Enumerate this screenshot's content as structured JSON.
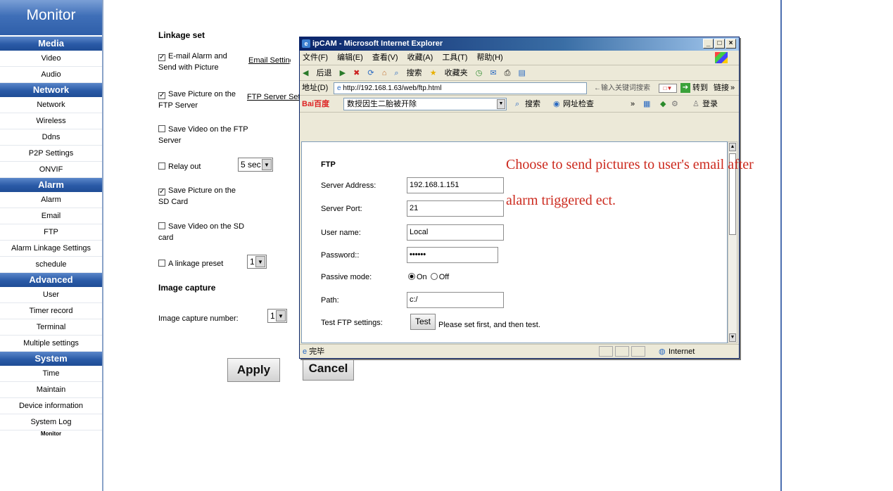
{
  "sidebar": {
    "title": "Monitor",
    "sections": [
      {
        "heading": "Media",
        "items": [
          "Video",
          "Audio"
        ]
      },
      {
        "heading": "Network",
        "items": [
          "Network",
          "Wireless",
          "Ddns",
          "P2P Settings",
          "ONVIF"
        ]
      },
      {
        "heading": "Alarm",
        "items": [
          "Alarm",
          "Email",
          "FTP",
          "Alarm Linkage Settings",
          "schedule"
        ]
      },
      {
        "heading": "Advanced",
        "items": [
          "User",
          "Timer record",
          "Terminal",
          "Multiple settings"
        ]
      },
      {
        "heading": "System",
        "items": [
          "Time",
          "Maintain",
          "Device information",
          "System Log"
        ]
      }
    ],
    "footer": "Monitor"
  },
  "linkage": {
    "title": "Linkage set",
    "email_alarm": "E-mail Alarm and Send with Picture",
    "email_setting_link": "Email Setting",
    "save_ftp": "Save Picture on the FTP Server",
    "ftp_setting_link": "FTP Server Setti",
    "save_video_ftp": "Save Video on the FTP Server",
    "relay_out": "Relay out",
    "relay_value": "5 sec",
    "save_sd": "Save Picture on the SD Card",
    "save_video_sd": "Save Video on the SD card",
    "linkage_preset": "A linkage preset",
    "preset_value": "1"
  },
  "capture": {
    "title": "Image capture",
    "number_label": "Image capture number:",
    "number_value": "1"
  },
  "buttons": {
    "apply": "Apply",
    "cancel": "Cancel"
  },
  "ie": {
    "title": "ipCAM - Microsoft Internet Explorer",
    "menu": [
      "文件(F)",
      "编辑(E)",
      "查看(V)",
      "收藏(A)",
      "工具(T)",
      "帮助(H)"
    ],
    "toolbar": [
      "后退",
      "搜索",
      "收藏夹"
    ],
    "addr_label": "地址(D)",
    "url": "http://192.168.1.63/web/ftp.html",
    "addr_hint": "←输入关键词搜索",
    "goto": "转到",
    "links": "链接",
    "baidu_logo": "Bai百度",
    "baidu_text": "数授因生二胎被开除",
    "baidu_search": "搜索",
    "baidu_check": "网址检查",
    "login": "登录",
    "status_done": "完毕",
    "status_zone": "Internet"
  },
  "ftp": {
    "title": "FTP",
    "server_address_label": "Server Address:",
    "server_address": "192.168.1.151",
    "server_port_label": "Server Port:",
    "server_port": "21",
    "user_label": "User name:",
    "user": "Local",
    "password_label": "Password::",
    "password": "••••••",
    "passive_label": "Passive mode:",
    "passive_on": "On",
    "passive_off": "Off",
    "path_label": "Path:",
    "path": "c:/",
    "test_label": "Test FTP settings:",
    "test_button": "Test",
    "test_hint": "Please set first, and then test."
  },
  "annotation": {
    "line1": "Choose to send pictures to user's email after",
    "line2": "alarm triggered ect."
  },
  "colors": {
    "sidebar_blue": "#2f5fa9",
    "annotation_red": "#cc2a1e"
  }
}
